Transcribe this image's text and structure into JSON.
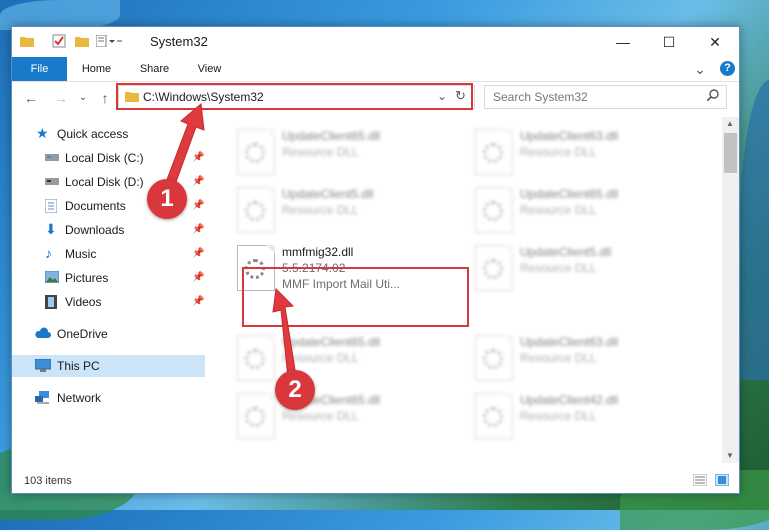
{
  "window": {
    "title": "System32",
    "min_glyph": "—",
    "max_glyph": "☐",
    "close_glyph": "✕"
  },
  "ribbon": {
    "tabs": [
      "File",
      "Home",
      "Share",
      "View"
    ],
    "collapse_glyph": "⌄",
    "help_glyph": "?"
  },
  "address": {
    "path": "C:\\Windows\\System32",
    "search_placeholder": "Search System32"
  },
  "sidebar": {
    "items": [
      {
        "label": "Quick access",
        "icon": "star-icon",
        "pinned": false
      },
      {
        "label": "Local Disk (C:)",
        "icon": "drive-icon",
        "pinned": true
      },
      {
        "label": "Local Disk (D:)",
        "icon": "drive-icon",
        "pinned": true
      },
      {
        "label": "Documents",
        "icon": "documents-icon",
        "pinned": true
      },
      {
        "label": "Downloads",
        "icon": "download-icon",
        "pinned": true
      },
      {
        "label": "Music",
        "icon": "music-icon",
        "pinned": true
      },
      {
        "label": "Pictures",
        "icon": "pictures-icon",
        "pinned": true
      },
      {
        "label": "Videos",
        "icon": "videos-icon",
        "pinned": true
      },
      {
        "label": "OneDrive",
        "icon": "cloud-icon",
        "pinned": false
      },
      {
        "label": "This PC",
        "icon": "computer-icon",
        "pinned": false,
        "selected": true
      },
      {
        "label": "Network",
        "icon": "network-icon",
        "pinned": false
      }
    ]
  },
  "files": [
    {
      "name": "UpdateClient65.dll",
      "desc": "Resource DLL"
    },
    {
      "name": "UpdateClient63.dll",
      "desc": "Resource DLL"
    },
    {
      "name": "UpdateClient5.dll",
      "desc": "Resource DLL"
    },
    {
      "name": "UpdateClient65.dll",
      "desc": "Resource DLL"
    },
    {
      "name": "mmfmig32.dll",
      "version": "5.5.2174.02",
      "desc": "MMF Import Mail Uti...",
      "highlighted": true
    },
    {
      "name": "UpdateClient5.dll",
      "desc": "Resource DLL"
    },
    {
      "name": "UpdateClient65.dll",
      "desc": "Resource DLL"
    },
    {
      "name": "UpdateClient63.dll",
      "desc": "Resource DLL"
    },
    {
      "name": "UpdateClient65.dll",
      "desc": "Resource DLL"
    },
    {
      "name": "UpdateClient42.dll",
      "desc": "Resource DLL"
    }
  ],
  "status": {
    "item_count": "103 items"
  },
  "callouts": [
    "1",
    "2"
  ],
  "colors": {
    "accent": "#1979ca",
    "highlight": "#d9373c",
    "selected": "#cce4f7"
  }
}
